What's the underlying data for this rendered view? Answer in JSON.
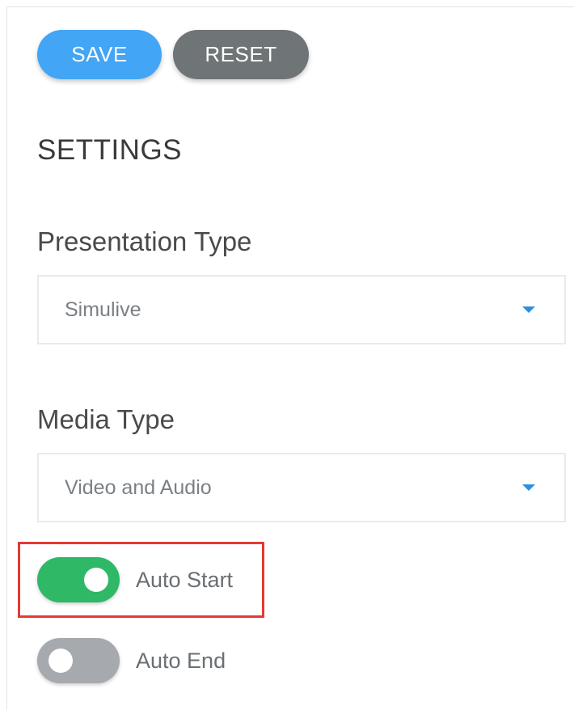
{
  "toolbar": {
    "save_label": "SAVE",
    "reset_label": "RESET"
  },
  "settings": {
    "title": "SETTINGS",
    "presentation_type": {
      "label": "Presentation Type",
      "value": "Simulive"
    },
    "media_type": {
      "label": "Media Type",
      "value": "Video and Audio"
    },
    "auto_start": {
      "label": "Auto Start",
      "enabled": true
    },
    "auto_end": {
      "label": "Auto End",
      "enabled": false
    }
  },
  "colors": {
    "save_button": "#42a5f5",
    "reset_button": "#6f7477",
    "toggle_on": "#2fb866",
    "toggle_off": "#a6aaae",
    "dropdown_caret": "#2f8fde",
    "highlight": "#e53935"
  },
  "icons": {
    "dropdown": "caret-down-icon"
  }
}
